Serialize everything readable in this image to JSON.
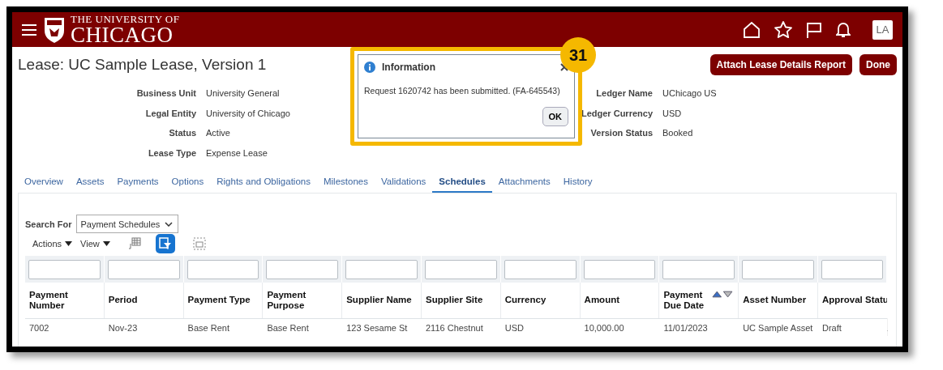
{
  "header": {
    "logo_top": "THE UNIVERSITY OF",
    "logo_main": "CHICAGO",
    "avatar": "LA"
  },
  "page_title": "Lease: UC Sample Lease, Version 1",
  "buttons": [
    {
      "label": "Attach Lease Details Report"
    },
    {
      "label": "Done"
    }
  ],
  "fields_left": [
    {
      "label": "Business Unit",
      "value": "University General"
    },
    {
      "label": "Legal Entity",
      "value": "University of Chicago"
    },
    {
      "label": "Status",
      "value": "Active"
    },
    {
      "label": "Lease Type",
      "value": "Expense Lease"
    }
  ],
  "fields_right": [
    {
      "label": "Ledger Name",
      "value": "UChicago US"
    },
    {
      "label": "Ledger Currency",
      "value": "USD"
    },
    {
      "label": "Version Status",
      "value": "Booked"
    }
  ],
  "dialog": {
    "title": "Information",
    "message": "Request 1620742 has been submitted. (FA-645543)",
    "button": "OK",
    "callout": "31"
  },
  "tabs": [
    {
      "label": "Overview",
      "selected": false
    },
    {
      "label": "Assets",
      "selected": false
    },
    {
      "label": "Payments",
      "selected": false
    },
    {
      "label": "Options",
      "selected": false
    },
    {
      "label": "Rights and Obligations",
      "selected": false
    },
    {
      "label": "Milestones",
      "selected": false
    },
    {
      "label": "Validations",
      "selected": false
    },
    {
      "label": "Schedules",
      "selected": true
    },
    {
      "label": "Attachments",
      "selected": false
    },
    {
      "label": "History",
      "selected": false
    }
  ],
  "search": {
    "label": "Search For",
    "value": "Payment Schedules"
  },
  "toolbar": {
    "actions": "Actions",
    "view": "View",
    "filter_on": true
  },
  "table": {
    "columns": [
      {
        "label": "Payment Number",
        "sorted": false
      },
      {
        "label": "Period",
        "sorted": false
      },
      {
        "label": "Payment Type",
        "sorted": false
      },
      {
        "label": "Payment Purpose",
        "sorted": false
      },
      {
        "label": "Supplier Name",
        "sorted": false
      },
      {
        "label": "Supplier Site",
        "sorted": false
      },
      {
        "label": "Currency",
        "sorted": false
      },
      {
        "label": "Amount",
        "sorted": false
      },
      {
        "label": "Payment Due Date",
        "sorted": true
      },
      {
        "label": "Asset Number",
        "sorted": false
      },
      {
        "label": "Approval Statu",
        "sorted": false
      }
    ],
    "rows": [
      [
        "7002",
        "Nov-23",
        "Base Rent",
        "Base Rent",
        "123 Sesame St",
        "2116 Chestnut",
        "USD",
        "10,000.00",
        "11/01/2023",
        "UC Sample Asset",
        "Draft"
      ]
    ]
  }
}
